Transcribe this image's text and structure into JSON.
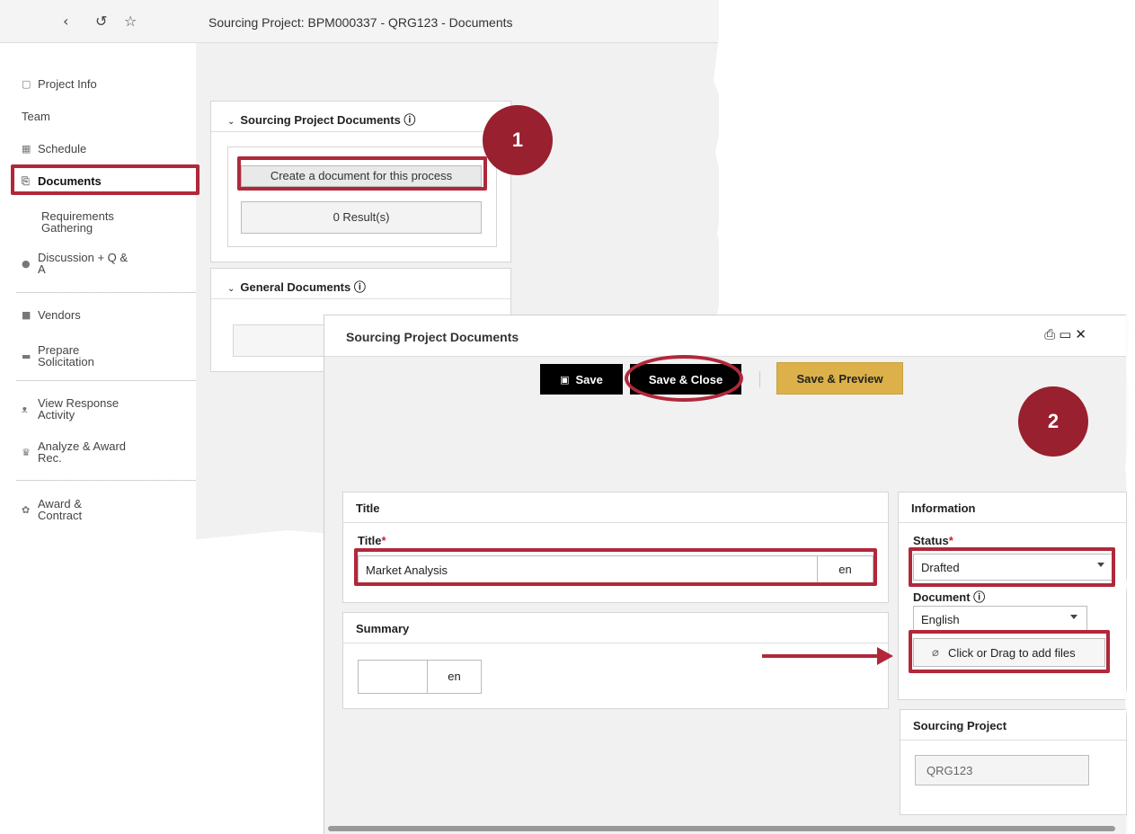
{
  "back": {
    "nav": {
      "back": "‹",
      "history": "↺",
      "favorite": "☆"
    },
    "page_title": "Sourcing Project: BPM000337 - QRG123 - Documents",
    "sidebar": {
      "items": [
        {
          "label": "Project Info",
          "icon": "clipboard-icon",
          "glyph": "▢"
        },
        {
          "label": "Team",
          "icon": "",
          "glyph": ""
        },
        {
          "label": "Schedule",
          "icon": "calendar-icon",
          "glyph": "▦"
        },
        {
          "label": "Documents",
          "icon": "document-icon",
          "glyph": "⎘"
        },
        {
          "label": "Requirements Gathering",
          "icon": "",
          "glyph": ""
        },
        {
          "label": "Discussion + Q & A",
          "icon": "chat-icon",
          "glyph": "●"
        },
        {
          "label": "Vendors",
          "icon": "truck-icon",
          "glyph": "■"
        },
        {
          "label": "Prepare Solicitation",
          "icon": "folder-icon",
          "glyph": "▬"
        },
        {
          "label": "View Response Activity",
          "icon": "binoculars-icon",
          "glyph": "ᴥ"
        },
        {
          "label": "Analyze & Award Rec.",
          "icon": "trophy-icon",
          "glyph": "♛"
        },
        {
          "label": "Award & Contract",
          "icon": "handshake-icon",
          "glyph": "✿"
        }
      ]
    },
    "sourcing_docs_panel": {
      "title": "Sourcing Project Documents ⓘ",
      "create_button": "Create a document for this process",
      "results": "0 Result(s)"
    },
    "general_docs_panel": {
      "title": "General Documents ⓘ"
    }
  },
  "badges": {
    "one": "1",
    "two": "2"
  },
  "dialog": {
    "title": "Sourcing Project Documents",
    "window_icons": "⎙▭✕",
    "toolbar": {
      "save_label": "Save",
      "save_icon": "▣",
      "save_close_label": "Save & Close",
      "save_preview_label": "Save & Preview"
    },
    "title_card": {
      "header": "Title",
      "field_label": "Title",
      "required_mark": "*",
      "value": "Market Analysis",
      "lang": "en"
    },
    "summary_card": {
      "header": "Summary",
      "value": "",
      "lang": "en"
    },
    "information_card": {
      "header": "Information",
      "status_label": "Status",
      "required_mark": "*",
      "status_value": "Drafted",
      "document_label": "Document ⓘ",
      "language_value": "English",
      "attach_label": "Click or Drag to add files",
      "attach_icon": "⌀"
    },
    "sourcing_project_card": {
      "header": "Sourcing Project",
      "value": "QRG123"
    }
  },
  "colors": {
    "callout_red": "#b0283a",
    "badge": "#98202f",
    "gold_button": "#dcb14a"
  }
}
